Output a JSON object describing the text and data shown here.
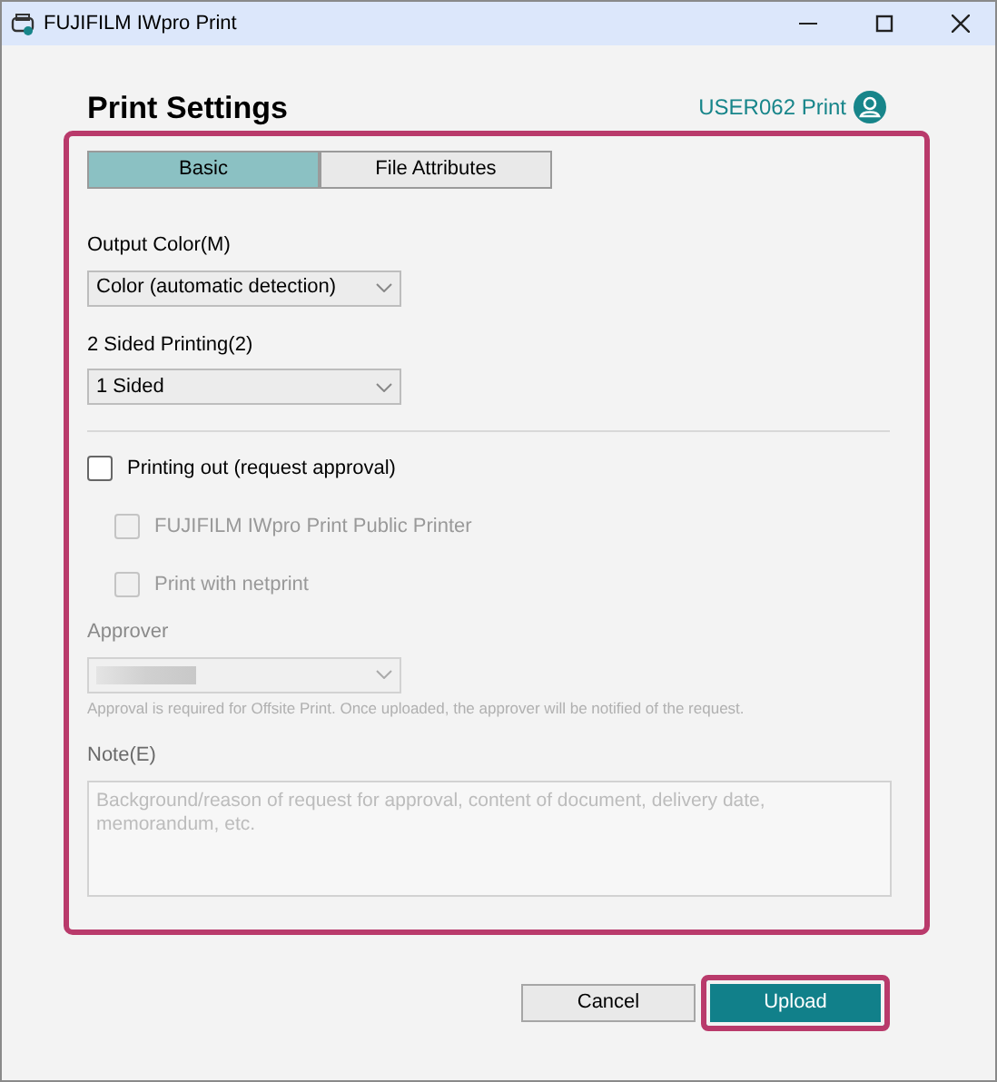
{
  "window": {
    "title": "FUJIFILM IWpro Print"
  },
  "heading": "Print Settings",
  "user": "USER062 Print",
  "tabs": [
    {
      "label": "Basic",
      "selected": true
    },
    {
      "label": "File Attributes",
      "selected": false
    }
  ],
  "output_color": {
    "label": "Output Color(M)",
    "value": "Color (automatic detection)"
  },
  "sided": {
    "label": "2 Sided Printing(2)",
    "value": "1 Sided"
  },
  "options": [
    {
      "label": "Printing out (request approval)",
      "checked": false,
      "disabled": false,
      "children": [
        {
          "label": "FUJIFILM IWpro Print Public Printer",
          "checked": false,
          "disabled": true
        },
        {
          "label": "Print with netprint",
          "checked": false,
          "disabled": true
        }
      ]
    }
  ],
  "approver": {
    "label": "Approver",
    "disabled": true,
    "hint": "Approval is required for Offsite Print. Once uploaded, the approver will be notified of the request."
  },
  "note": {
    "label": "Note(E)",
    "placeholder": "Background/reason of request for approval, content of document, delivery date, memorandum, etc."
  },
  "buttons": [
    {
      "label": "Cancel",
      "kind": "secondary"
    },
    {
      "label": "Upload",
      "kind": "primary"
    }
  ]
}
